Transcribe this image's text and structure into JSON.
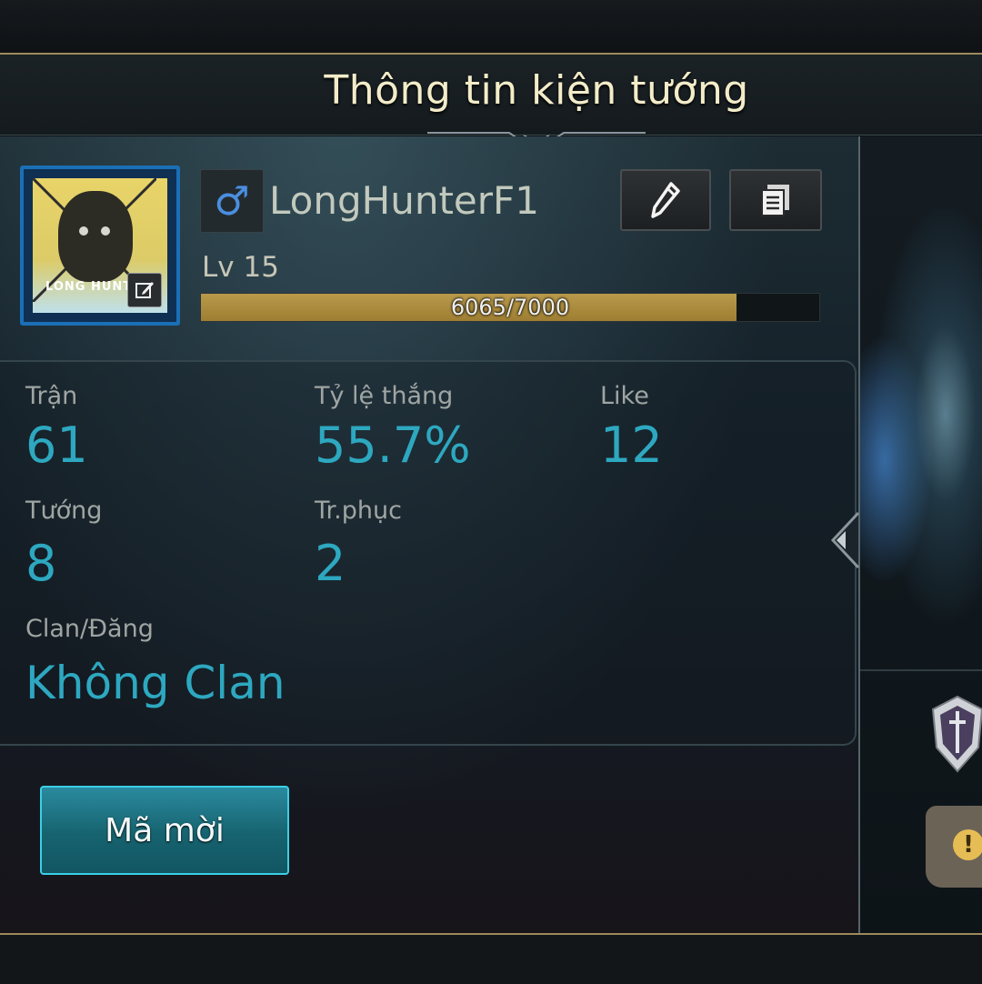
{
  "header": {
    "title": "Thông tin kiện tướng"
  },
  "profile": {
    "gender_symbol": "♂",
    "name": "LongHunterF1",
    "level_label": "Lv 15",
    "xp_text": "6065/7000",
    "xp_current": 6065,
    "xp_max": 7000,
    "avatar_text": "LONG HUNT"
  },
  "stats": {
    "matches_label": "Trận",
    "matches_value": "61",
    "winrate_label": "Tỷ lệ thắng",
    "winrate_value": "55.7%",
    "like_label": "Like",
    "like_value": "12",
    "heroes_label": "Tướng",
    "heroes_value": "8",
    "skins_label": "Tr.phục",
    "skins_value": "2",
    "clan_label": "Clan/Đăng",
    "clan_value": "Không Clan"
  },
  "actions": {
    "invite_label": "Mã mời"
  },
  "notice": {
    "symbol": "!"
  },
  "colors": {
    "accent_teal": "#2da8c0",
    "gold": "#9c8a5c",
    "xp_fill": "#b99a4b",
    "gender_blue": "#4a8ee0"
  },
  "icons": {
    "edit": "pencil-icon",
    "copy": "copy-icon",
    "avatar_edit": "edit-icon",
    "rank": "rank-shield-icon",
    "notice": "exclamation-icon"
  }
}
